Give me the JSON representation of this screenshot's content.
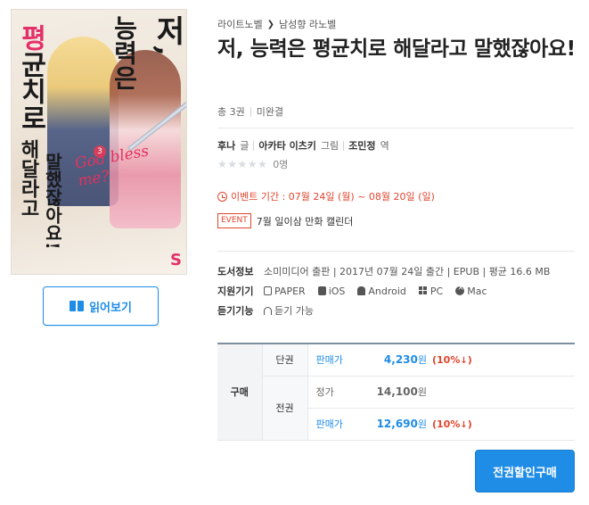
{
  "cover": {
    "title_chars": [
      "저,",
      "능력은",
      "평",
      "균",
      "치",
      "로",
      "해달라고",
      "말했잖아요!"
    ],
    "volume_no": "3",
    "script_text": "God bless me?",
    "logo": "S",
    "colors": {
      "title_pink": "#e4306a",
      "accent": "#d3405b"
    }
  },
  "read_button": {
    "label": "읽어보기",
    "icon": "book-icon"
  },
  "breadcrumb": {
    "items": [
      "라이트노벨",
      "남성향 라노벨"
    ],
    "separator": "❯"
  },
  "title": "저, 능력은 평균치로 해달라고 말했잖아요!",
  "meta": {
    "volumes": "총 3권",
    "status": "미완결"
  },
  "authors": [
    {
      "name": "후나",
      "role": "글"
    },
    {
      "name": "아카타 이츠키",
      "role": "그림"
    },
    {
      "name": "조민정",
      "role": "역"
    }
  ],
  "rating": {
    "stars": "★★★★★",
    "count": "0명",
    "score": 0
  },
  "event": {
    "date_text": "이벤트 기간 : 07월 24일 (월) ~ 08월 20일 (일)",
    "badge": "EVENT",
    "name": "7월 일이삼 만화 캘린더"
  },
  "book_info": {
    "label": "도서정보",
    "text": "소미미디어 출판 | 2017년 07월 24일 출간 | EPUB | 평균 16.6 MB"
  },
  "devices": {
    "label": "지원기기",
    "items": [
      "PAPER",
      "iOS",
      "Android",
      "PC",
      "Mac"
    ]
  },
  "listen": {
    "label": "듣기기능",
    "text": "듣기 가능"
  },
  "purchase": {
    "header": "구매",
    "single": {
      "kind": "단권",
      "label": "판매가",
      "price": "4,230",
      "unit": "원",
      "discount": "(10%",
      "arrow": "↓",
      "close": ")"
    },
    "set": {
      "kind": "전권",
      "list_label": "정가",
      "list_price": "14,100",
      "list_unit": "원",
      "sale_label": "판매가",
      "sale_price": "12,690",
      "sale_unit": "원",
      "discount": "(10%",
      "arrow": "↓",
      "close": ")"
    }
  },
  "buy_all_button": "전권할인구매",
  "colors": {
    "primary": "#1f8ce6",
    "event_red": "#e0462f"
  }
}
